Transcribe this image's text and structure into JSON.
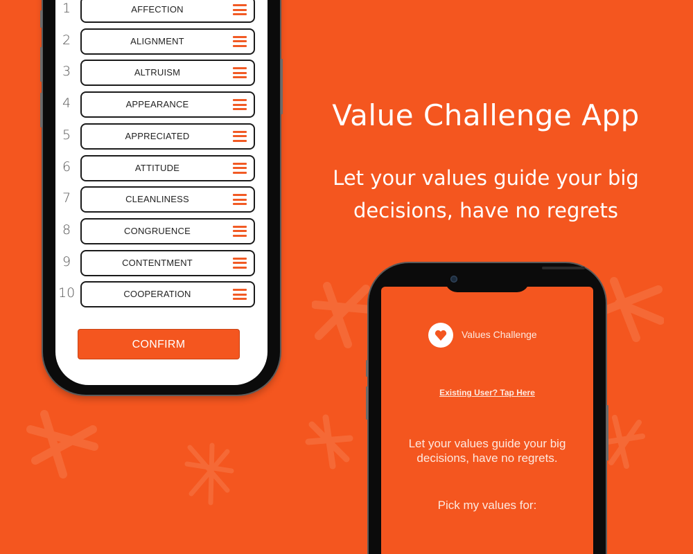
{
  "colors": {
    "background": "#f4561f",
    "accent": "#f15a24",
    "phone_frame": "#0b0b0b",
    "list_screen": "#ffffff",
    "text_light": "#fde9e0"
  },
  "marketing": {
    "headline": "Value Challenge App",
    "subhead_line1": "Let your values guide your big",
    "subhead_line2": "decisions, have no regrets"
  },
  "ranking_screen": {
    "values": [
      {
        "rank": "1",
        "label": "AFFECTION"
      },
      {
        "rank": "2",
        "label": "ALIGNMENT"
      },
      {
        "rank": "3",
        "label": "ALTRUISM"
      },
      {
        "rank": "4",
        "label": "APPEARANCE"
      },
      {
        "rank": "5",
        "label": "APPRECIATED"
      },
      {
        "rank": "6",
        "label": "ATTITUDE"
      },
      {
        "rank": "7",
        "label": "CLEANLINESS"
      },
      {
        "rank": "8",
        "label": "CONGRUENCE"
      },
      {
        "rank": "9",
        "label": "CONTENTMENT"
      },
      {
        "rank": "10",
        "label": "COOPERATION"
      }
    ],
    "drag_icon": "drag-handle-icon",
    "confirm_label": "CONFIRM"
  },
  "welcome_screen": {
    "logo_icon": "heart-icon",
    "app_name": "Values Challenge",
    "existing_user_link": "Existing User? Tap Here",
    "tagline_line1": "Let your values guide your big",
    "tagline_line2": "decisions, have no regrets.",
    "pick_label": "Pick my values for:"
  }
}
